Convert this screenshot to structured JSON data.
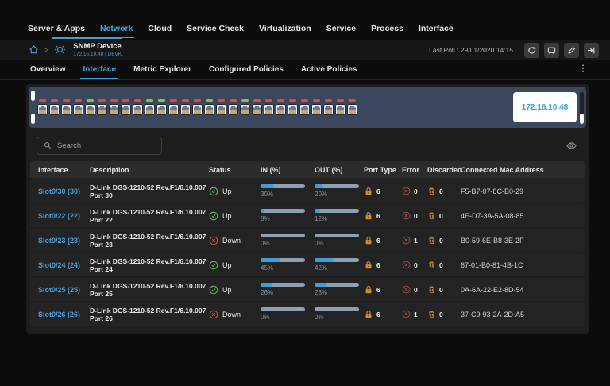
{
  "nav": {
    "items": [
      {
        "label": "Server & Apps",
        "active": false
      },
      {
        "label": "Network",
        "active": true
      },
      {
        "label": "Cloud",
        "active": false
      },
      {
        "label": "Service Check",
        "active": false
      },
      {
        "label": "Virtualization",
        "active": false
      },
      {
        "label": "Service",
        "active": false
      },
      {
        "label": "Process",
        "active": false
      },
      {
        "label": "Interface",
        "active": false
      }
    ]
  },
  "breadcrumb": {
    "device_name": "SNMP Device",
    "device_sub": "172.16.10.48 | DEVK"
  },
  "poll": {
    "label": "Last Poll :",
    "value": "29/01/2020 14:15",
    "actions": [
      "refresh-icon",
      "monitor-icon",
      "edit-pencil-icon",
      "sign-in-icon"
    ]
  },
  "tabs": {
    "items": [
      {
        "label": "Overview",
        "active": false
      },
      {
        "label": "Interface",
        "active": true
      },
      {
        "label": "Metric Explorer",
        "active": false
      },
      {
        "label": "Configured Policies",
        "active": false
      },
      {
        "label": "Active Policies",
        "active": false
      }
    ]
  },
  "device_panel": {
    "ip": "172.16.10.48",
    "ports": [
      "down",
      "down",
      "down",
      "down",
      "up",
      "down",
      "down",
      "down",
      "down",
      "up",
      "up",
      "down",
      "down",
      "down",
      "up",
      "down",
      "down",
      "up",
      "down",
      "down",
      "down",
      "down",
      "down",
      "down",
      "down",
      "down",
      "down"
    ]
  },
  "search": {
    "placeholder": "Search"
  },
  "table": {
    "columns": [
      "Interface",
      "Description",
      "Status",
      "IN (%)",
      "OUT (%)",
      "Port Type",
      "Error",
      "Discarded",
      "Connected Mac Address"
    ],
    "rows": [
      {
        "interface": "Slot0/30 (30)",
        "description": "D-Link DGS-1210-52 Rev.F1/6.10.007 Port 30",
        "status": "Up",
        "in_pct": 30,
        "out_pct": 20,
        "port_type": 6,
        "error": 0,
        "discarded": 0,
        "mac": "F5-B7-07-8C-B0-29"
      },
      {
        "interface": "Slot0/22 (22)",
        "description": "D-Link DGS-1210-52 Rev.F1/6.10.007 Port 22",
        "status": "Up",
        "in_pct": 8,
        "out_pct": 12,
        "port_type": 6,
        "error": 0,
        "discarded": 0,
        "mac": "4E-D7-3A-5A-08-85"
      },
      {
        "interface": "Slot0/23 (23)",
        "description": "D-Link DGS-1210-52 Rev.F1/6.10.007 Port 23",
        "status": "Down",
        "in_pct": 0,
        "out_pct": 0,
        "port_type": 6,
        "error": 1,
        "discarded": 0,
        "mac": "B0-59-6E-B8-3E-2F"
      },
      {
        "interface": "Slot0/24 (24)",
        "description": "D-Link DGS-1210-52 Rev.F1/6.10.007 Port 24",
        "status": "Up",
        "in_pct": 45,
        "out_pct": 42,
        "port_type": 6,
        "error": 0,
        "discarded": 0,
        "mac": "67-01-B0-81-4B-1C"
      },
      {
        "interface": "Slot0/25 (25)",
        "description": "D-Link DGS-1210-52 Rev.F1/6.10.007 Port 25",
        "status": "Up",
        "in_pct": 26,
        "out_pct": 28,
        "port_type": 6,
        "error": 0,
        "discarded": 0,
        "mac": "0A-6A-22-E2-8D-54"
      },
      {
        "interface": "Slot0/26 (26)",
        "description": "D-Link DGS-1210-52 Rev.F1/6.10.007 Port 26",
        "status": "Down",
        "in_pct": 0,
        "out_pct": 0,
        "port_type": 6,
        "error": 1,
        "discarded": 0,
        "mac": "37-C9-93-2A-2D-A5"
      }
    ]
  },
  "colors": {
    "accent": "#3d9fd6",
    "status_up": "#5cb85c",
    "status_down": "#c9504c",
    "led_up": "#86c440",
    "led_down": "#e04848",
    "panel": "#3a475c",
    "bar_track": "#8c9fb3",
    "bar_fill": "#3d9fd6",
    "port_type_icon": "#d78b2d",
    "discarded_icon": "#d78b2d"
  }
}
